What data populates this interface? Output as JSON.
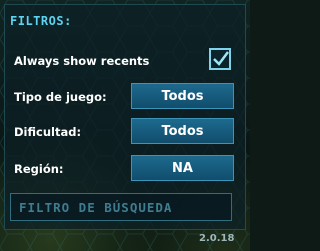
{
  "panel": {
    "title": "FILTROS:"
  },
  "recents": {
    "label": "Always show recents",
    "checked": true
  },
  "filters": [
    {
      "label": "Tipo de juego:",
      "value": "Todos"
    },
    {
      "label": "Dificultad:",
      "value": "Todos"
    },
    {
      "label": "Región:",
      "value": "NA"
    }
  ],
  "search": {
    "placeholder": "FILTRO DE BÚSQUEDA"
  },
  "footer": {
    "version": "2.0.18"
  },
  "colors": {
    "accent": "#5cd3f0",
    "button": "#1d6a8e",
    "text": "#ffffff"
  }
}
